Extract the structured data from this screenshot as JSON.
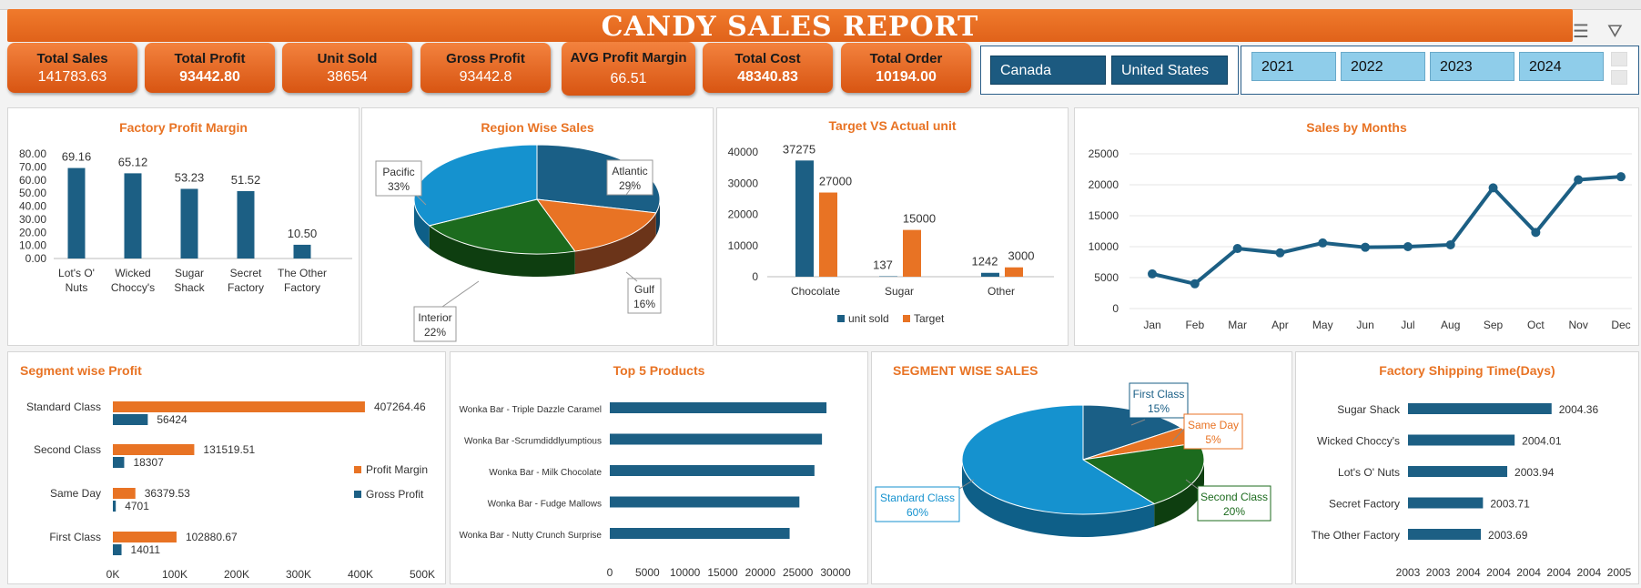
{
  "title": "CANDY SALES REPORT",
  "kpis": [
    {
      "label": "Total Sales",
      "value": "141783.63"
    },
    {
      "label": "Total Profit",
      "value": "93442.80"
    },
    {
      "label": "Unit Sold",
      "value": "38654"
    },
    {
      "label": "Gross Profit",
      "value": "93442.8"
    },
    {
      "label": "AVG Profit Margin",
      "value": "66.51"
    },
    {
      "label": "Total Cost",
      "value": "48340.83"
    },
    {
      "label": "Total Order",
      "value": "10194.00"
    }
  ],
  "country_slicer": [
    "Canada",
    "United States"
  ],
  "year_slicer": [
    "2021",
    "2022",
    "2023",
    "2024"
  ],
  "colors": {
    "orange": "#e87324",
    "blue": "#1c5f84",
    "green": "#1c6b1e",
    "lightblue": "#1592cf",
    "brown": "#6b3419"
  },
  "chart_data": [
    {
      "type": "bar",
      "title": "Factory Profit Margin",
      "categories": [
        "Lot's O' Nuts",
        "Wicked Choccy's",
        "Sugar Shack",
        "Secret Factory",
        "The Other Factory"
      ],
      "values": [
        69.16,
        65.12,
        53.23,
        51.52,
        10.5
      ],
      "labels": [
        "69.16",
        "65.12",
        "53.23",
        "51.52",
        "10.50"
      ],
      "ylim": [
        0,
        80
      ],
      "ticks": [
        "0.00",
        "10.00",
        "20.00",
        "30.00",
        "40.00",
        "50.00",
        "60.00",
        "70.00",
        "80.00"
      ]
    },
    {
      "type": "pie",
      "title": "Region Wise Sales",
      "slices": [
        {
          "name": "Atlantic",
          "value": 29,
          "label": "29%"
        },
        {
          "name": "Gulf",
          "value": 16,
          "label": "16%"
        },
        {
          "name": "Interior",
          "value": 22,
          "label": "22%"
        },
        {
          "name": "Pacific",
          "value": 33,
          "label": "33%"
        }
      ]
    },
    {
      "type": "bar",
      "title": "Target VS Actual unit",
      "categories": [
        "Chocolate",
        "Sugar",
        "Other"
      ],
      "series": [
        {
          "name": "unit sold",
          "values": [
            37275,
            137,
            1242
          ]
        },
        {
          "name": "Target",
          "values": [
            27000,
            15000,
            3000
          ]
        }
      ],
      "ylim": [
        0,
        40000
      ],
      "ticks": [
        "0",
        "10000",
        "20000",
        "30000",
        "40000"
      ]
    },
    {
      "type": "line",
      "title": "Sales by Months",
      "x": [
        "Jan",
        "Feb",
        "Mar",
        "Apr",
        "May",
        "Jun",
        "Jul",
        "Aug",
        "Sep",
        "Oct",
        "Nov",
        "Dec"
      ],
      "values": [
        5600,
        4000,
        9700,
        9000,
        10600,
        9900,
        10000,
        10300,
        19500,
        12300,
        20800,
        21300
      ],
      "ylim": [
        0,
        25000
      ],
      "ticks": [
        "0",
        "5000",
        "10000",
        "15000",
        "20000",
        "25000"
      ]
    },
    {
      "type": "bar",
      "title": "Segment wise Profit",
      "categories": [
        "Standard Class",
        "Second Class",
        "Same Day",
        "First Class"
      ],
      "series": [
        {
          "name": "Profit Margin",
          "values": [
            407264.46,
            131519.51,
            36379.53,
            102880.67
          ]
        },
        {
          "name": "Gross Profit",
          "values": [
            56424,
            18307,
            4701,
            14011
          ]
        }
      ],
      "xlim": [
        0,
        500000
      ],
      "ticks": [
        "0K",
        "100K",
        "200K",
        "300K",
        "400K",
        "500K"
      ]
    },
    {
      "type": "bar",
      "title": "Top 5 Products",
      "categories": [
        "Wonka Bar - Triple Dazzle Caramel",
        "Wonka Bar -Scrumdiddlyumptious",
        "Wonka Bar - Milk Chocolate",
        "Wonka Bar - Fudge Mallows",
        "Wonka Bar - Nutty Crunch Surprise"
      ],
      "values": [
        28800,
        28200,
        27200,
        25200,
        23900
      ],
      "xlim": [
        0,
        30000
      ],
      "ticks": [
        "0",
        "5000",
        "10000",
        "15000",
        "20000",
        "25000",
        "30000"
      ]
    },
    {
      "type": "pie",
      "title": "SEGMENT WISE SALES",
      "slices": [
        {
          "name": "First Class",
          "value": 15,
          "label": "15%"
        },
        {
          "name": "Same Day",
          "value": 5,
          "label": "5%"
        },
        {
          "name": "Second Class",
          "value": 20,
          "label": "20%"
        },
        {
          "name": "Standard Class",
          "value": 60,
          "label": "60%"
        }
      ]
    },
    {
      "type": "bar",
      "title": "Factory Shipping Time(Days)",
      "categories": [
        "Sugar Shack",
        "Wicked Choccy's",
        "Lot's O' Nuts",
        "Secret Factory",
        "The Other Factory"
      ],
      "values": [
        2004.36,
        2004.01,
        2003.94,
        2003.71,
        2003.69
      ],
      "labels": [
        "2004.36",
        "2004.01",
        "2003.94",
        "2003.71",
        "2003.69"
      ],
      "xlim": [
        2003,
        2005
      ],
      "ticks": [
        "2003",
        "2003",
        "2004",
        "2004",
        "2004",
        "2004",
        "2004",
        "2005"
      ]
    }
  ]
}
